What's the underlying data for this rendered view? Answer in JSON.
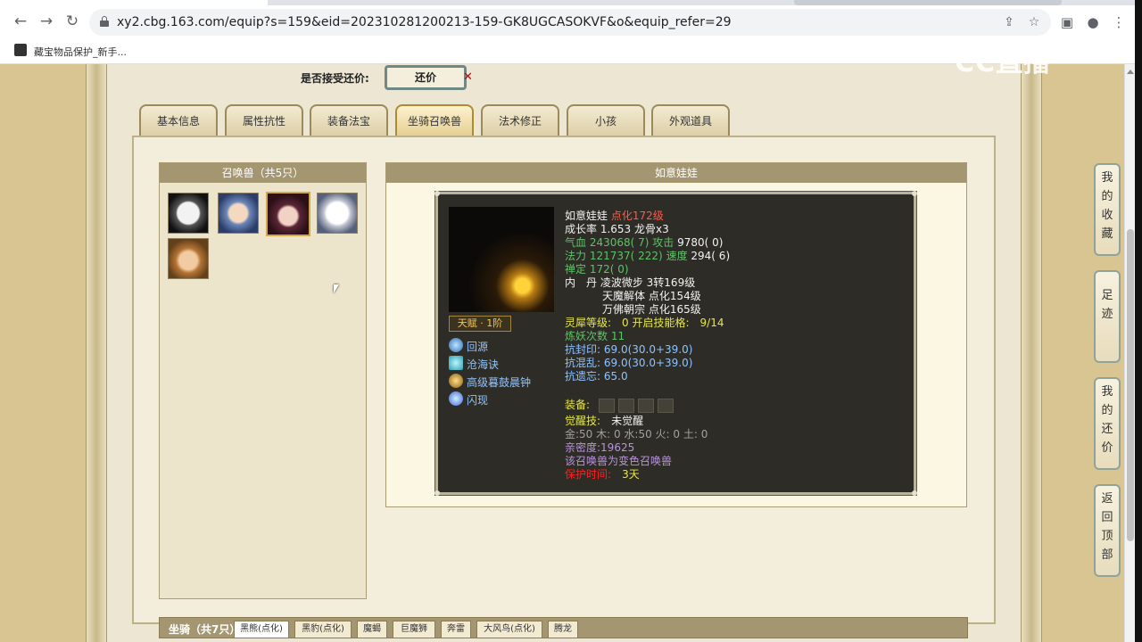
{
  "browser": {
    "url": "xy2.cbg.163.com/equip?s=159&eid=202310281200213-159-GK8UGCASOKVF&o&equip_refer=29",
    "bookmark_label": "藏宝物品保护_新手...",
    "icons": [
      "back-icon",
      "forward-icon",
      "reload-icon",
      "lock-icon",
      "share-icon",
      "star-icon",
      "sidebar-icon",
      "profile-icon",
      "menu-icon"
    ]
  },
  "watermark": "CC直播",
  "offer": {
    "label": "是否接受还价:",
    "button": "还价"
  },
  "tabs": [
    {
      "label": "基本信息",
      "active": false
    },
    {
      "label": "属性抗性",
      "active": false
    },
    {
      "label": "装备法宝",
      "active": false
    },
    {
      "label": "坐骑召唤兽",
      "active": true
    },
    {
      "label": "法术修正",
      "active": false
    },
    {
      "label": "小孩",
      "active": false
    },
    {
      "label": "外观道具",
      "active": false
    }
  ],
  "summon_list": {
    "header": "召唤兽（共5只）",
    "count": 5,
    "selected_index": 2
  },
  "detail": {
    "header": "如意娃娃",
    "talent": "天赋 · 1阶",
    "skills": [
      "回源",
      "沧海诀",
      "高级暮鼓晨钟",
      "闪现"
    ],
    "name": "如意娃娃",
    "level": "点化172级",
    "growth": "成长率 1.653 龙骨x3",
    "hp_label": "气血",
    "hp_value": "243068( 7)",
    "atk_label": "攻击",
    "atk_value": "9780( 0)",
    "mp_label": "法力",
    "mp_value": "121737( 222)",
    "spd_label": "速度",
    "spd_value": "294( 6)",
    "zen_label": "禅定",
    "zen_value": "172( 0)",
    "inner_label": "内　丹",
    "inner": [
      "凌波微步 3转169级",
      "天魔解体 点化154级",
      "万佛朝宗 点化165级"
    ],
    "spirit_line": "灵犀等级:　0 开启技能格:　9/14",
    "refine_label": "炼妖次数",
    "refine_value": "11",
    "resist": [
      "抗封印: 69.0(30.0+39.0)",
      "抗混乱: 69.0(30.0+39.0)",
      "抗遗忘: 65.0"
    ],
    "equip_label": "装备:",
    "awaken_label": "觉醒技:",
    "awaken_value": "未觉醒",
    "elements": "金:50 木: 0 水:50 火: 0 土: 0",
    "intimacy": "亲密度:19625",
    "variant": "该召唤兽为变色召唤兽",
    "protect_label": "保护时间:",
    "protect_value": "3天"
  },
  "mounts": {
    "title": "坐骑（共7只）",
    "tabs": [
      "黑熊(点化)",
      "黑豹(点化)",
      "魔蝎",
      "巨魔狮",
      "奔雷",
      "大风鸟(点化)",
      "腾龙"
    ]
  },
  "side_nav": [
    "我的收藏",
    "足迹",
    "我的还价",
    "返回顶部"
  ]
}
